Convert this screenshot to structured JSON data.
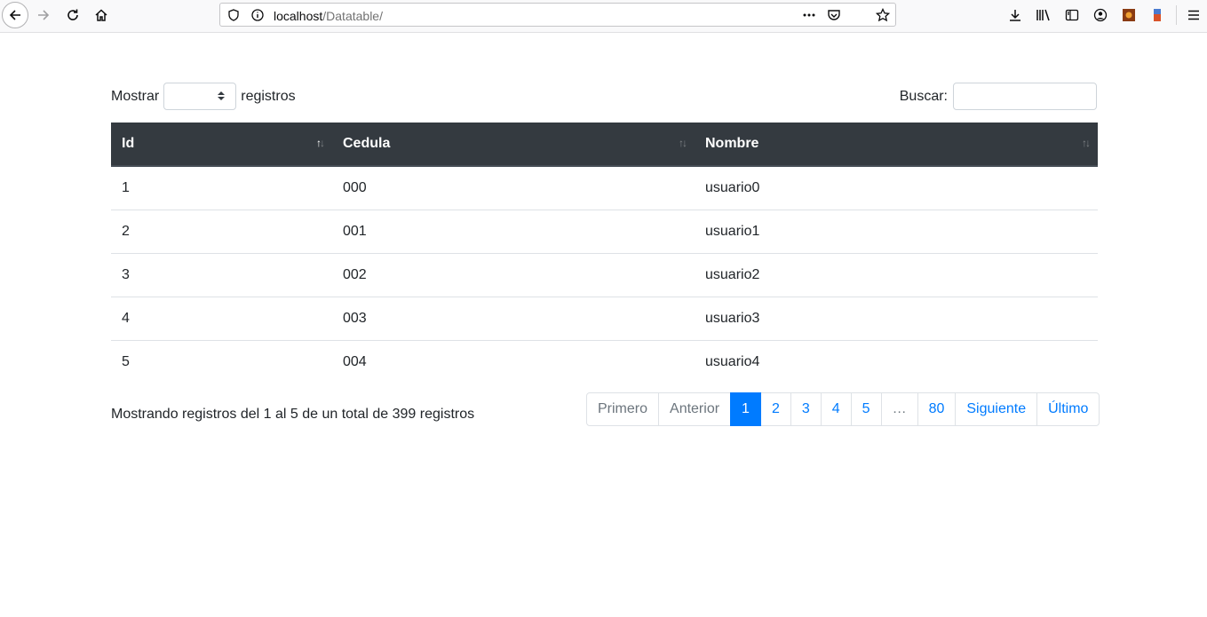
{
  "browser": {
    "url_host": "localhost",
    "url_path": "/Datatable/"
  },
  "length": {
    "prefix": "Mostrar",
    "suffix": "registros",
    "selected": ""
  },
  "filter": {
    "label": "Buscar:",
    "value": ""
  },
  "table": {
    "columns": [
      "Id",
      "Cedula",
      "Nombre"
    ],
    "rows": [
      [
        "1",
        "000",
        "usuario0"
      ],
      [
        "2",
        "001",
        "usuario1"
      ],
      [
        "3",
        "002",
        "usuario2"
      ],
      [
        "4",
        "003",
        "usuario3"
      ],
      [
        "5",
        "004",
        "usuario4"
      ]
    ]
  },
  "info": "Mostrando registros del 1 al 5 de un total de 399 registros",
  "pagination": {
    "first": "Primero",
    "previous": "Anterior",
    "pages": [
      "1",
      "2",
      "3",
      "4",
      "5",
      "…",
      "80"
    ],
    "next": "Siguiente",
    "last": "Último",
    "active": "1"
  },
  "colors": {
    "accent": "#007bff",
    "header_bg": "#343a40"
  }
}
